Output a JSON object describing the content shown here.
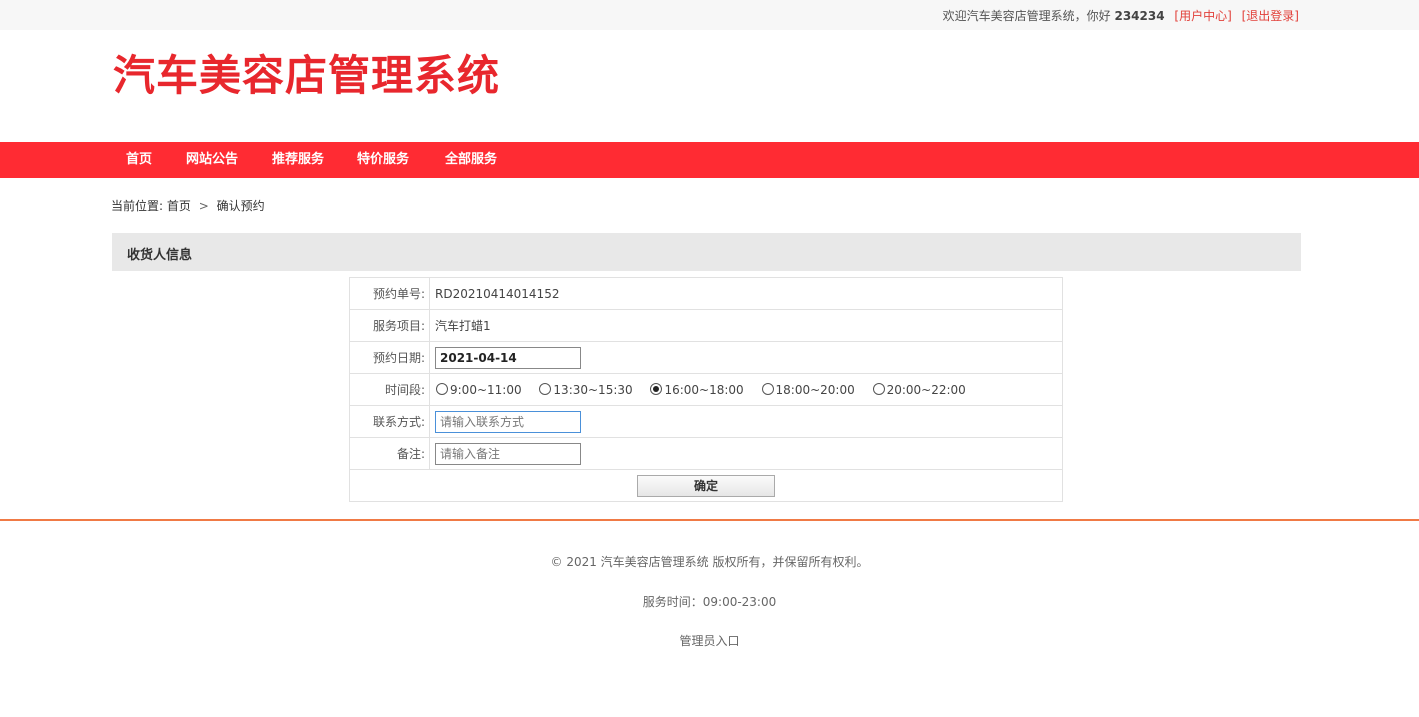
{
  "topbar": {
    "welcome": "欢迎汽车美容店管理系统，你好",
    "username": "234234",
    "user_center": "[用户中心]",
    "logout": "[退出登录]"
  },
  "logo": {
    "text": "汽车美容店管理系统"
  },
  "nav": {
    "items": [
      "首页",
      "网站公告",
      "推荐服务",
      "特价服务",
      "全部服务"
    ]
  },
  "breadcrumb": {
    "prefix": "当前位置:",
    "home": "首页",
    "separator": ">",
    "current": "确认预约"
  },
  "section": {
    "title": "收货人信息"
  },
  "form": {
    "order_no_label": "预约单号:",
    "order_no": "RD20210414014152",
    "service_label": "服务项目:",
    "service": "汽车打蜡1",
    "date_label": "预约日期:",
    "date_value": "2021-04-14",
    "time_label": "时间段:",
    "time_slots": [
      "9:00~11:00",
      "13:30~15:30",
      "16:00~18:00",
      "18:00~20:00",
      "20:00~22:00"
    ],
    "time_selected": "16:00~18:00",
    "contact_label": "联系方式:",
    "contact_placeholder": "请输入联系方式",
    "note_label": "备注:",
    "note_placeholder": "请输入备注",
    "submit_label": "确定"
  },
  "footer": {
    "copyright": "© 2021 汽车美容店管理系统 版权所有，并保留所有权利。",
    "service_hours": "服务时间：09:00-23:00",
    "admin_link": "管理员入口"
  },
  "colors": {
    "brand_red": "#ff2b33",
    "logo_red": "#e8272d",
    "footer_line": "#f07a45"
  }
}
